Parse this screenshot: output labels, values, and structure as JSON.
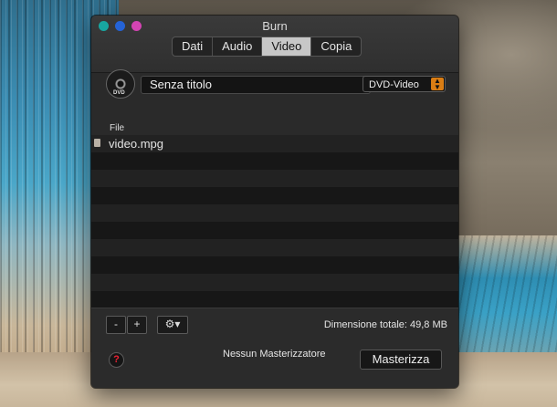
{
  "window": {
    "title": "Burn",
    "tabs": [
      {
        "label": "Dati"
      },
      {
        "label": "Audio"
      },
      {
        "label": "Video"
      },
      {
        "label": "Copia"
      }
    ],
    "active_tab": "Video"
  },
  "disc": {
    "icon": "dvd-icon",
    "label": "DVD"
  },
  "name_field": {
    "value": "Senza titolo"
  },
  "format_select": {
    "value": "DVD-Video"
  },
  "list": {
    "column_header": "File",
    "files": [
      {
        "name": "video.mpg",
        "icon": "file-icon"
      }
    ]
  },
  "toolbar": {
    "remove_label": "-",
    "add_label": "+",
    "gear_label": "⚙▾",
    "size_text": "Dimensione totale: 49,8 MB"
  },
  "footer": {
    "help_label": "?",
    "burner_text": "Nessun Masterizzatore",
    "burn_button": "Masterizza"
  },
  "colors": {
    "accent": "#d97d14",
    "traffic1": "#18a7a1",
    "traffic2": "#2463d7",
    "traffic3": "#d444b3"
  }
}
